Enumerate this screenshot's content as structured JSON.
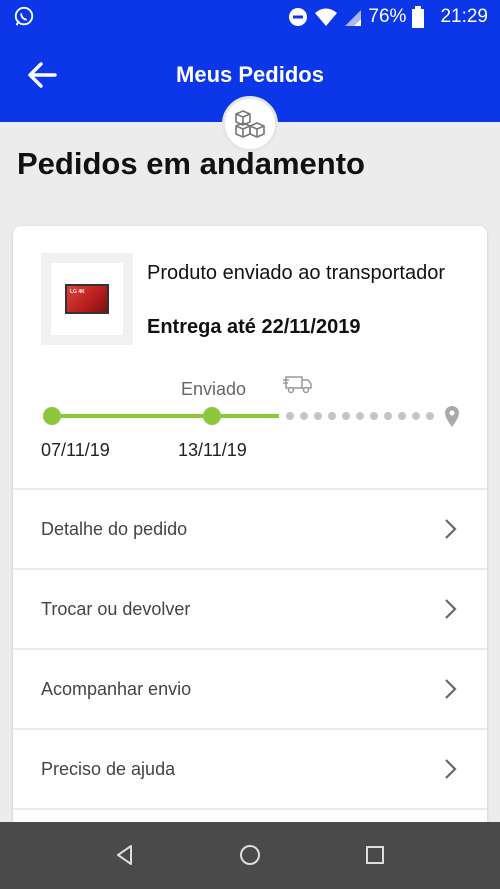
{
  "status_bar": {
    "battery": "76%",
    "time": "21:29",
    "icons": [
      "whatsapp-icon",
      "dnd-icon",
      "wifi-icon",
      "signal-icon",
      "battery-icon"
    ]
  },
  "app_bar": {
    "title": "Meus Pedidos",
    "back_icon": "arrow-left-icon",
    "badge_icon": "boxes-icon"
  },
  "page": {
    "title": "Pedidos em andamento"
  },
  "order": {
    "status": "Produto enviado ao transportador",
    "delivery": "Entrega até 22/11/2019",
    "thumbnail_icon": "tv-product-image",
    "tracking": {
      "current_step_label": "Enviado",
      "dates": [
        "07/11/19",
        "13/11/19"
      ],
      "colors": {
        "done": "#8cc63f",
        "pending": "#c4c4c4"
      }
    }
  },
  "menu": [
    {
      "label": "Detalhe do pedido"
    },
    {
      "label": "Trocar ou devolver"
    },
    {
      "label": "Acompanhar envio"
    },
    {
      "label": "Preciso de ajuda"
    }
  ],
  "nav_bar": {
    "icons": [
      "back-triangle-icon",
      "home-circle-icon",
      "recents-square-icon"
    ]
  },
  "colors": {
    "primary": "#0b37e8",
    "accent_green": "#8cc63f"
  }
}
